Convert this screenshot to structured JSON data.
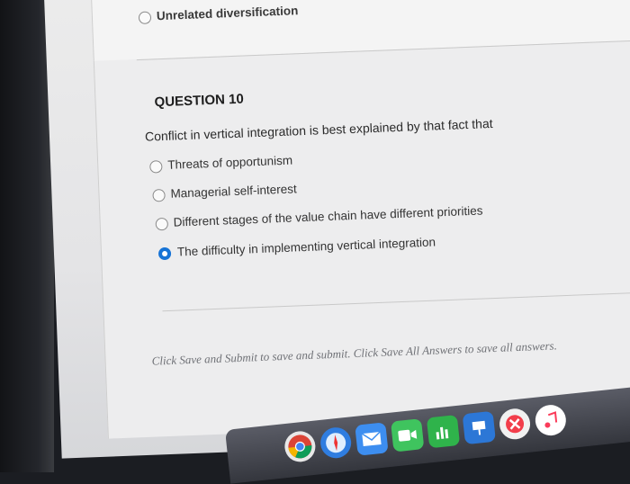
{
  "prev_question": {
    "last_option": "Unrelated diversification"
  },
  "question": {
    "title": "QUESTION 10",
    "prompt": "Conflict in vertical integration is best explained by that fact that",
    "options": [
      {
        "label": "Threats of opportunism",
        "selected": false
      },
      {
        "label": "Managerial self-interest",
        "selected": false
      },
      {
        "label": "Different stages of the value chain have different priorities",
        "selected": false
      },
      {
        "label": "The difficulty in implementing vertical integration",
        "selected": true
      }
    ]
  },
  "footer": {
    "instruction": "Click Save and Submit to save and submit. Click Save All Answers to save all answers."
  },
  "dock": {
    "icons": [
      "chrome-icon",
      "safari-icon",
      "mail-icon",
      "facetime-icon",
      "numbers-icon",
      "keynote-icon",
      "news-icon",
      "music-icon"
    ]
  }
}
